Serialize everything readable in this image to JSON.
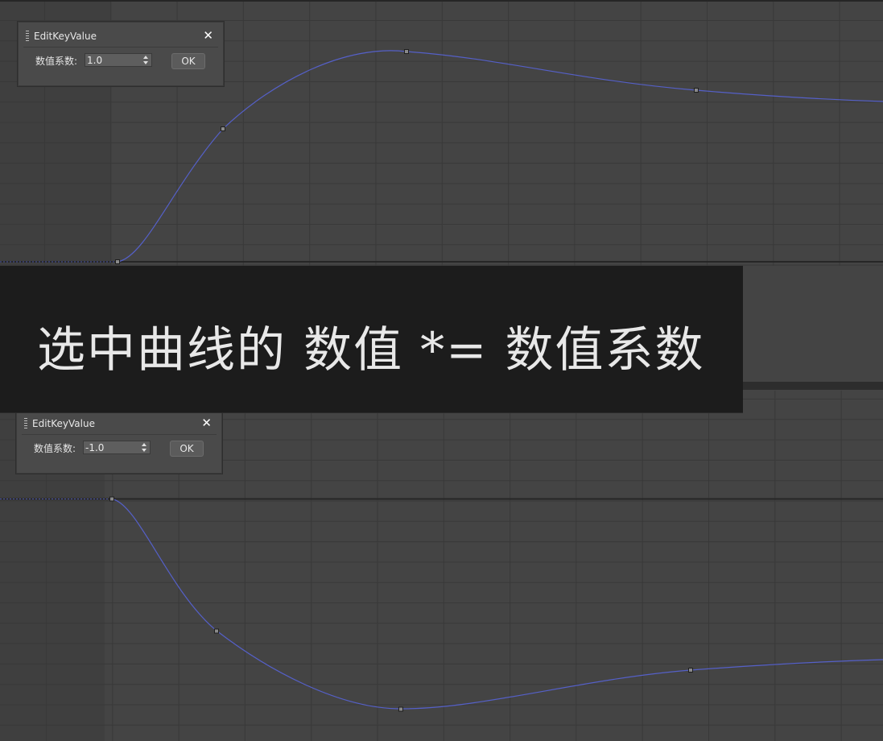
{
  "top_panel": {
    "dialog": {
      "title": "EditKeyValue",
      "close_icon": "close-icon",
      "field_label": "数值系数:",
      "field_value": "1.0",
      "ok_label": "OK"
    }
  },
  "bottom_panel": {
    "dialog": {
      "title": "EditKeyValue",
      "close_icon": "close-icon",
      "field_label": "数值系数:",
      "field_value": "-1.0",
      "ok_label": "OK"
    }
  },
  "caption": {
    "text": "选中曲线的 数值 *= 数值系数"
  },
  "colors": {
    "background": "#444444",
    "grid_line": "#393939",
    "curve": "#5560c8",
    "caption_bg": "#1c1c1c",
    "caption_text": "#e8e8e8"
  }
}
